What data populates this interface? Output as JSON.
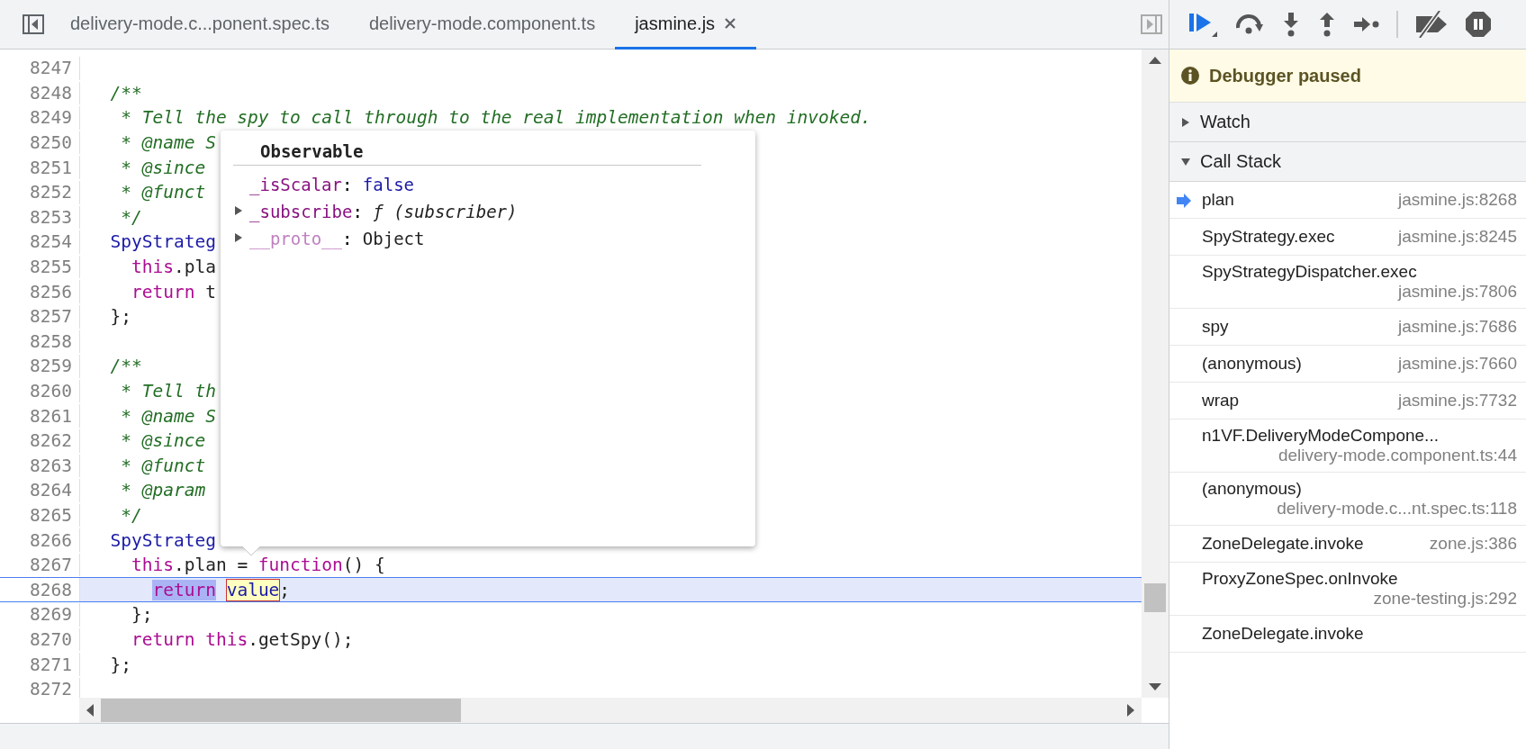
{
  "editor": {
    "tabs": [
      {
        "label": "delivery-mode.c...ponent.spec.ts",
        "selected": false,
        "closable": false
      },
      {
        "label": "delivery-mode.component.ts",
        "selected": false,
        "closable": false
      },
      {
        "label": "jasmine.js",
        "selected": true,
        "closable": true
      }
    ],
    "lines": [
      {
        "number": "8247",
        "current": false
      },
      {
        "number": "8248",
        "current": false,
        "segments": [
          {
            "kind": "comment",
            "text": "  /**"
          }
        ]
      },
      {
        "number": "8249",
        "current": false,
        "segments": [
          {
            "kind": "comment",
            "text": "   * Tell the spy to call through to the real implementation when invoked."
          }
        ]
      },
      {
        "number": "8250",
        "current": false,
        "segments": [
          {
            "kind": "comment",
            "text": "   * @name S"
          }
        ]
      },
      {
        "number": "8251",
        "current": false,
        "segments": [
          {
            "kind": "comment",
            "text": "   * @since"
          }
        ]
      },
      {
        "number": "8252",
        "current": false,
        "segments": [
          {
            "kind": "comment",
            "text": "   * @funct"
          }
        ]
      },
      {
        "number": "8253",
        "current": false,
        "segments": [
          {
            "kind": "comment",
            "text": "   */"
          }
        ]
      },
      {
        "number": "8254",
        "current": false,
        "segments": [
          {
            "kind": "name",
            "text": "  SpyStrateg"
          }
        ]
      },
      {
        "number": "8255",
        "current": false,
        "segments": [
          {
            "kind": "keyword",
            "text": "    this"
          },
          {
            "kind": "plain",
            "text": ".pla"
          }
        ]
      },
      {
        "number": "8256",
        "current": false,
        "segments": [
          {
            "kind": "keyword",
            "text": "    return"
          },
          {
            "kind": "plain",
            "text": " t"
          }
        ]
      },
      {
        "number": "8257",
        "current": false,
        "segments": [
          {
            "kind": "plain",
            "text": "  };"
          }
        ]
      },
      {
        "number": "8258",
        "current": false
      },
      {
        "number": "8259",
        "current": false,
        "segments": [
          {
            "kind": "comment",
            "text": "  /**"
          }
        ]
      },
      {
        "number": "8260",
        "current": false,
        "segments": [
          {
            "kind": "comment",
            "text": "   * Tell th"
          }
        ]
      },
      {
        "number": "8261",
        "current": false,
        "segments": [
          {
            "kind": "comment",
            "text": "   * @name S"
          }
        ]
      },
      {
        "number": "8262",
        "current": false,
        "segments": [
          {
            "kind": "comment",
            "text": "   * @since"
          }
        ]
      },
      {
        "number": "8263",
        "current": false,
        "segments": [
          {
            "kind": "comment",
            "text": "   * @funct"
          }
        ]
      },
      {
        "number": "8264",
        "current": false,
        "segments": [
          {
            "kind": "comment",
            "text": "   * @param"
          }
        ]
      },
      {
        "number": "8265",
        "current": false,
        "segments": [
          {
            "kind": "comment",
            "text": "   */"
          }
        ]
      },
      {
        "number": "8266",
        "current": false,
        "segments": [
          {
            "kind": "name",
            "text": "  SpyStrateg"
          }
        ]
      },
      {
        "number": "8267",
        "current": false,
        "segments": [
          {
            "kind": "keyword",
            "text": "    this"
          },
          {
            "kind": "plain",
            "text": ".plan = "
          },
          {
            "kind": "keyword",
            "text": "function"
          },
          {
            "kind": "plain",
            "text": "() {"
          }
        ]
      },
      {
        "number": "8268",
        "current": true,
        "segments": [
          {
            "kind": "selected",
            "text": "      return"
          },
          {
            "kind": "hovered",
            "text": " value"
          },
          {
            "kind": "plain",
            "text": ";"
          }
        ]
      },
      {
        "number": "8269",
        "current": false,
        "segments": [
          {
            "kind": "plain",
            "text": "    };"
          }
        ]
      },
      {
        "number": "8270",
        "current": false,
        "segments": [
          {
            "kind": "keyword",
            "text": "    return"
          },
          {
            "kind": "keyword",
            "text": " this"
          },
          {
            "kind": "plain",
            "text": ".getSpy();"
          }
        ]
      },
      {
        "number": "8271",
        "current": false,
        "segments": [
          {
            "kind": "plain",
            "text": "  };"
          }
        ]
      },
      {
        "number": "8272",
        "current": false
      }
    ]
  },
  "popover": {
    "title": "Observable",
    "properties": [
      {
        "name": "_isScalar",
        "separator": ":",
        "value": "false",
        "kind": "boolean",
        "expandable": false
      },
      {
        "name": "_subscribe",
        "separator": ":",
        "value": "ƒ (subscriber)",
        "kind": "function",
        "expandable": true
      },
      {
        "name": "__proto__",
        "separator": ":",
        "value": "Object",
        "kind": "internal",
        "expandable": true
      }
    ]
  },
  "debugger": {
    "status": "Debugger paused",
    "sections": [
      {
        "title": "Watch",
        "expanded": false
      },
      {
        "title": "Call Stack",
        "expanded": true
      }
    ],
    "call_stack": [
      {
        "name": "plan",
        "location": "jasmine.js:8268",
        "selected": true
      },
      {
        "name": "SpyStrategy.exec",
        "location": "jasmine.js:8245",
        "selected": false
      },
      {
        "name": "SpyStrategyDispatcher.exec",
        "location": "jasmine.js:7806",
        "selected": false
      },
      {
        "name": "spy",
        "location": "jasmine.js:7686",
        "selected": false
      },
      {
        "name": "(anonymous)",
        "location": "jasmine.js:7660",
        "selected": false
      },
      {
        "name": "wrap",
        "location": "jasmine.js:7732",
        "selected": false
      },
      {
        "name": "n1VF.DeliveryModeCompone...",
        "location": "delivery-mode.component.ts:44",
        "selected": false
      },
      {
        "name": "(anonymous)",
        "location": "delivery-mode.c...nt.spec.ts:118",
        "selected": false
      },
      {
        "name": "ZoneDelegate.invoke",
        "location": "zone.js:386",
        "selected": false
      },
      {
        "name": "ProxyZoneSpec.onInvoke",
        "location": "zone-testing.js:292",
        "selected": false
      },
      {
        "name": "ZoneDelegate.invoke",
        "selected": false
      }
    ]
  }
}
